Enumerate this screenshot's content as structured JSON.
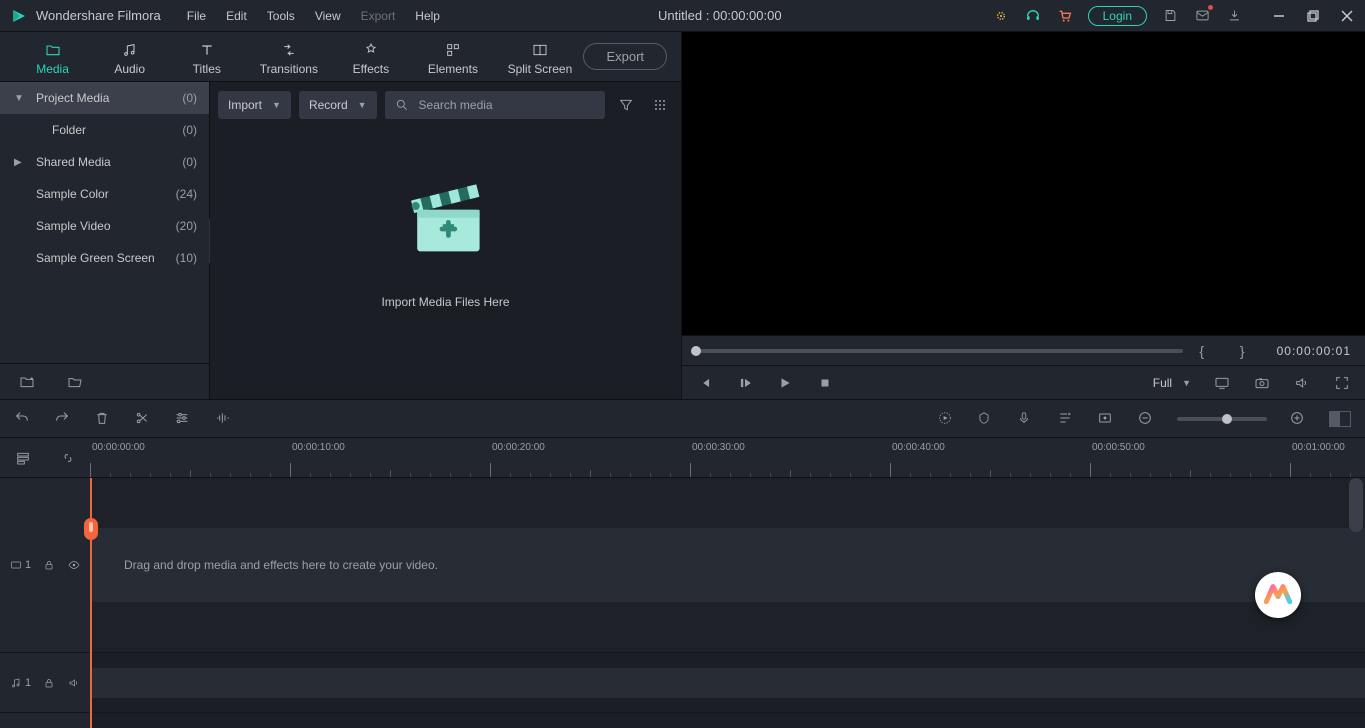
{
  "app": {
    "name": "Wondershare Filmora",
    "menu": [
      "File",
      "Edit",
      "Tools",
      "View",
      "Export",
      "Help"
    ],
    "menu_disabled_index": 4,
    "title": "Untitled : 00:00:00:00",
    "login": "Login"
  },
  "tabs": {
    "items": [
      "Media",
      "Audio",
      "Titles",
      "Transitions",
      "Effects",
      "Elements",
      "Split Screen"
    ],
    "active_index": 0,
    "export": "Export"
  },
  "sidebar": {
    "items": [
      {
        "label": "Project Media",
        "count": "(0)",
        "expandable": true,
        "expanded": true,
        "selected": true
      },
      {
        "label": "Folder",
        "count": "(0)",
        "child": true
      },
      {
        "label": "Shared Media",
        "count": "(0)",
        "expandable": true,
        "expanded": false
      },
      {
        "label": "Sample Color",
        "count": "(24)"
      },
      {
        "label": "Sample Video",
        "count": "(20)"
      },
      {
        "label": "Sample Green Screen",
        "count": "(10)"
      }
    ]
  },
  "browser": {
    "import": "Import",
    "record": "Record",
    "search_placeholder": "Search media",
    "drop_text": "Import Media Files Here"
  },
  "preview": {
    "timecode": "00:00:00:01",
    "quality": "Full"
  },
  "timeline": {
    "video_track_label": "1",
    "audio_track_label": "1",
    "hint": "Drag and drop media and effects here to create your video.",
    "ruler_labels": [
      "00:00:00:00",
      "00:00:10:00",
      "00:00:20:00",
      "00:00:30:00",
      "00:00:40:00",
      "00:00:50:00",
      "00:01:00:00"
    ]
  }
}
